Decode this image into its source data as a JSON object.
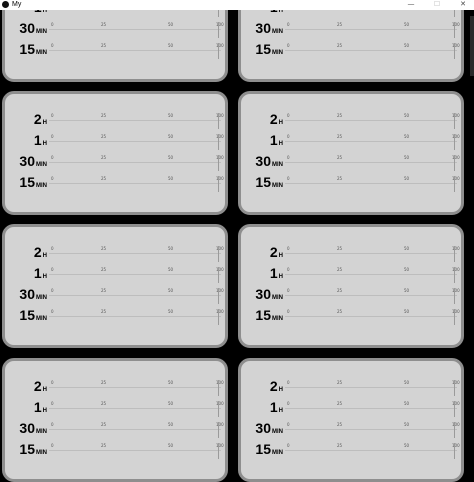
{
  "window": {
    "title": "My",
    "minimize_glyph": "—",
    "maximize_glyph": "☐",
    "close_glyph": "✕"
  },
  "slider_rows": [
    {
      "value": "2",
      "unit": "H"
    },
    {
      "value": "1",
      "unit": "H"
    },
    {
      "value": "30",
      "unit": "MIN"
    },
    {
      "value": "15",
      "unit": "MIN"
    }
  ],
  "tick_labels": [
    "0",
    "25",
    "50",
    "100"
  ],
  "panel_count": 8
}
